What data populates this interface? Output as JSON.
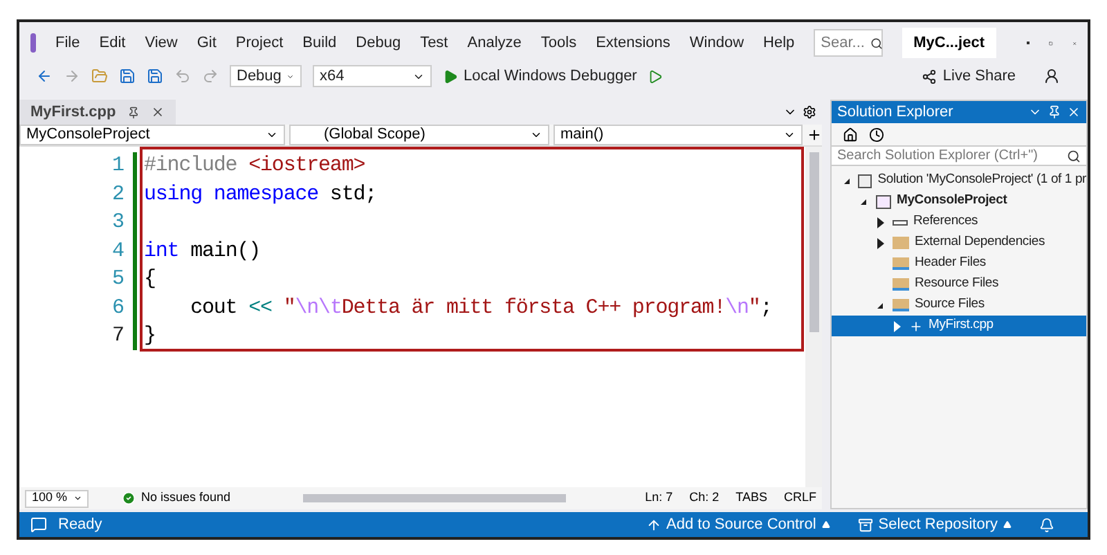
{
  "menu": {
    "items": [
      "File",
      "Edit",
      "View",
      "Git",
      "Project",
      "Build",
      "Debug",
      "Test",
      "Analyze",
      "Tools",
      "Extensions",
      "Window",
      "Help"
    ],
    "search": {
      "placeholder": "Sear..."
    },
    "solution_name": "MyC...ject"
  },
  "toolbar": {
    "configuration": "Debug",
    "platform": "x64",
    "debugger": "Local Windows Debugger",
    "live_share": "Live Share"
  },
  "document_tab": {
    "title": "MyFirst.cpp",
    "selected": true
  },
  "navigation_bar": {
    "project": "MyConsoleProject",
    "scope": "(Global Scope)",
    "member": "main()"
  },
  "editor": {
    "lines": [
      {
        "number": "1",
        "current": false,
        "tokens": [
          {
            "kind": "preproc",
            "text": "#include "
          },
          {
            "kind": "string",
            "text": "<iostream>"
          }
        ]
      },
      {
        "number": "2",
        "current": false,
        "tokens": [
          {
            "kind": "keyword",
            "text": "using"
          },
          {
            "kind": "keyword",
            "text": " namespace"
          },
          {
            "kind": "plain",
            "text": " std;"
          }
        ]
      },
      {
        "number": "3",
        "current": false
      },
      {
        "number": "4",
        "current": false,
        "tokens": [
          {
            "kind": "keyword",
            "text": "int"
          },
          {
            "kind": "plain",
            "text": " main()"
          }
        ]
      },
      {
        "number": "5",
        "current": false,
        "tokens": [
          {
            "kind": "plain",
            "text": "{"
          }
        ]
      },
      {
        "number": "6",
        "current": false,
        "tokens": [
          {
            "kind": "plain",
            "text": "    cout "
          },
          {
            "kind": "operator",
            "text": "<<"
          },
          {
            "kind": "string",
            "text": " \""
          },
          {
            "kind": "escape",
            "text": "\\n\\t"
          },
          {
            "kind": "string",
            "text": "Detta är mitt första C++ program!"
          },
          {
            "kind": "escape",
            "text": "\\n"
          },
          {
            "kind": "string",
            "text": "\""
          },
          {
            "kind": "plain",
            "text": ";"
          }
        ]
      },
      {
        "number": "7",
        "current": true,
        "tokens": [
          {
            "kind": "plain",
            "text": "}"
          }
        ]
      }
    ]
  },
  "editor_status": {
    "zoom": "100 %",
    "issues": "No issues found",
    "line": "Ln: 7",
    "column": "Ch: 2",
    "indent": "TABS",
    "line_ending": "CRLF"
  },
  "solution_explorer": {
    "title": "Solution Explorer",
    "search": {
      "placeholder": "Search Solution Explorer (Ctrl+\")"
    },
    "tree": [
      {
        "label": "Solution 'MyConsoleProject' (1 of 1 pr",
        "kind": "solution",
        "expanded": true,
        "selected": false,
        "children": [
          {
            "label": "MyConsoleProject",
            "kind": "project",
            "expanded": true,
            "selected": false,
            "children": [
              {
                "label": "References",
                "kind": "references",
                "expanded": false,
                "selected": false
              },
              {
                "label": "External Dependencies",
                "kind": "folder",
                "expanded": false,
                "selected": false
              },
              {
                "label": "Header Files",
                "kind": "filter",
                "selected": false
              },
              {
                "label": "Resource Files",
                "kind": "filter",
                "selected": false
              },
              {
                "label": "Source Files",
                "kind": "filter",
                "expanded": true,
                "selected": false,
                "children": [
                  {
                    "label": "MyFirst.cpp",
                    "kind": "cpp",
                    "expanded": false,
                    "selected": true
                  }
                ]
              }
            ]
          }
        ]
      }
    ]
  },
  "status_bar": {
    "state": "Ready",
    "source_control": "Add to Source Control",
    "repository": "Select Repository"
  }
}
